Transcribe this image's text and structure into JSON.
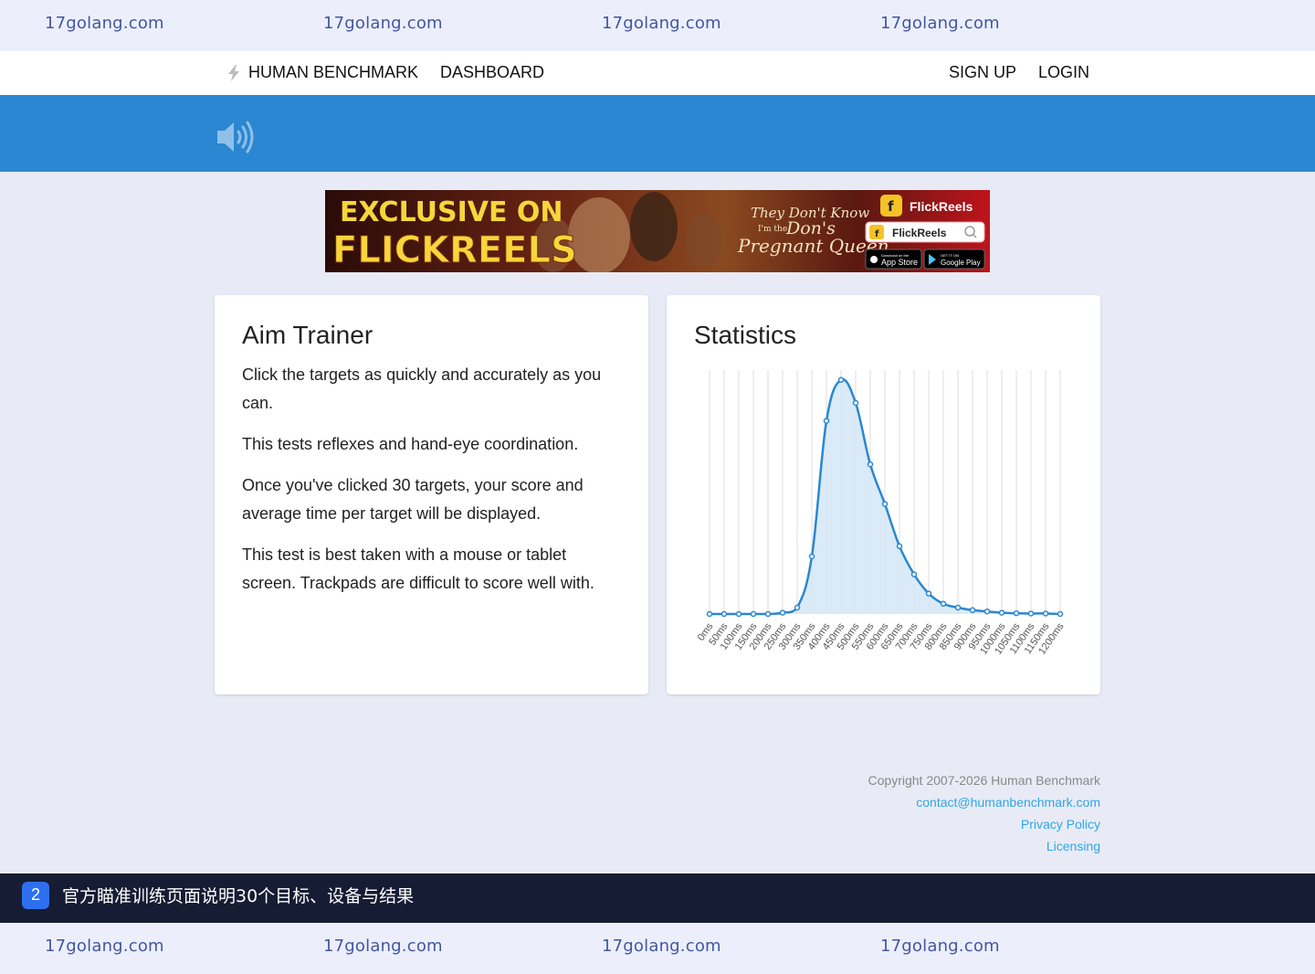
{
  "watermark": {
    "text": "17golang.com"
  },
  "nav": {
    "brand": "HUMAN BENCHMARK",
    "dashboard": "DASHBOARD",
    "signup": "SIGN UP",
    "login": "LOGIN"
  },
  "ad": {
    "line1": "EXCLUSIVE ON",
    "line2": "FLICKREELS",
    "show_line1": "They Don't Know",
    "show_line2": "I'm the",
    "show_line3": "Don's",
    "show_line4": "Pregnant Queen",
    "app_name": "FlickReels",
    "search_name": "FlickReels",
    "app_store": "App Store",
    "google_play": "Google Play",
    "app_store_small": "Download on the",
    "google_play_small": "GET IT ON"
  },
  "info": {
    "title": "Aim Trainer",
    "p1": "Click the targets as quickly and accurately as you can.",
    "p2": "This tests reflexes and hand-eye coordination.",
    "p3": "Once you've clicked 30 targets, your score and average time per target will be displayed.",
    "p4": "This test is best taken with a mouse or tablet screen. Trackpads are difficult to score well with."
  },
  "stats": {
    "title": "Statistics"
  },
  "chart_data": {
    "type": "area",
    "x": [
      "0ms",
      "50ms",
      "100ms",
      "150ms",
      "200ms",
      "250ms",
      "300ms",
      "350ms",
      "400ms",
      "450ms",
      "500ms",
      "550ms",
      "600ms",
      "650ms",
      "700ms",
      "750ms",
      "800ms",
      "850ms",
      "900ms",
      "950ms",
      "1000ms",
      "1050ms",
      "1100ms",
      "1150ms",
      "1200ms"
    ],
    "values": [
      0,
      0,
      0,
      0,
      0,
      0.5,
      2.5,
      22.5,
      75.5,
      91.5,
      82.5,
      58.5,
      43,
      26.5,
      15.5,
      8,
      4,
      2.5,
      1.5,
      1,
      0.5,
      0.3,
      0.2,
      0.2,
      0
    ],
    "ylim": [
      0,
      100
    ],
    "grid": "vertical",
    "legend": "none",
    "line_color": "#2b87d1",
    "fill_color": "#d4e6f5"
  },
  "footer": {
    "copyright": "Copyright 2007-2026 Human Benchmark",
    "contact": "contact@humanbenchmark.com",
    "privacy": "Privacy Policy",
    "licensing": "Licensing"
  },
  "caption": {
    "badge": "2",
    "text": "官方瞄准训练页面说明30个目标、设备与结果"
  }
}
